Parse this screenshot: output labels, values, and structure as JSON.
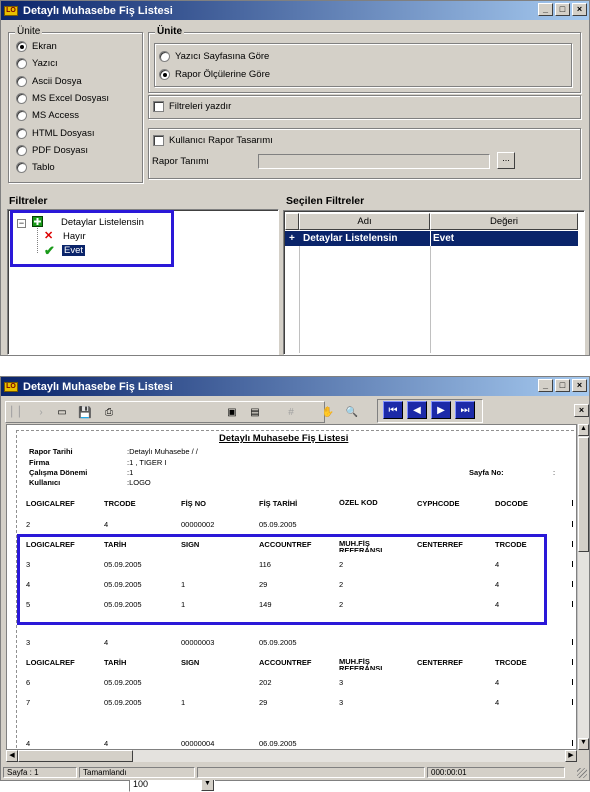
{
  "window1": {
    "title": "Detaylı Muhasebe Fiş Listesi",
    "min_label": "_",
    "max_label": "□",
    "close_label": "×",
    "unite_left": {
      "legend": "Ünite",
      "options": [
        "Ekran",
        "Yazıcı",
        "Ascii Dosya",
        "MS Excel Dosyası",
        "MS Access",
        "HTML Dosyası",
        "PDF Dosyası",
        "Tablo"
      ],
      "selected": 0
    },
    "unite_right": {
      "legend": "Ünite",
      "options": [
        "Yazıcı Sayfasına Göre",
        "Rapor Ölçülerine Göre"
      ],
      "selected": 1
    },
    "filtreleri_yazdir": "Filtreleri yazdır",
    "kullanici_rapor_tasarimi": "Kullanıcı Rapor Tasarımı",
    "rapor_tanimi_label": "Rapor Tanımı",
    "rapor_tanimi_value": "",
    "browse_label": "...",
    "filtreler_heading": "Filtreler",
    "tree": {
      "collapse_glyph": "−",
      "root": "Detaylar Listelensin",
      "children": [
        "Hayır",
        "Evet"
      ],
      "selected_child": "Evet"
    },
    "secilen_heading": "Seçilen Filtreler",
    "secilen_columns": [
      "Adı",
      "Değeri"
    ],
    "secilen_rows": [
      {
        "marker": "+",
        "name": "Detaylar Listelensin",
        "value": "Evet"
      }
    ]
  },
  "window2": {
    "title": "Detaylı Muhasebe Fiş Listesi",
    "min_label": "_",
    "max_label": "□",
    "close_label": "×",
    "zoom_value": "100",
    "close_small": "×",
    "report": {
      "title": "Detaylı Muhasebe Fiş Listesi",
      "header": {
        "rapor_tarihi_label": "Rapor Tarihi",
        "rapor_tarihi_value": ":Detaylı Muhasebe     /  /",
        "firma_label": "Firma",
        "firma_value": ":1          , TIGER I",
        "donem_label": "Çalışma Dönemi",
        "donem_value": ":1",
        "kullanici_label": "Kullanıcı",
        "kullanici_value": ":LOGO",
        "sayfa_label": "Sayfa No:",
        "sayfa_value": ":"
      },
      "hdr1": [
        "LOGICALREF",
        "TRCODE",
        "FİŞ NO",
        "FİŞ TARİHİ",
        "ÖZEL KOD",
        "CYPHCODE",
        "DOCODE"
      ],
      "row1": [
        "2",
        "4",
        "00000002",
        "05.09.2005",
        "",
        "",
        ""
      ],
      "hdr2": [
        "LOGICALREF",
        "TARİH",
        "SIGN",
        "ACCOUNTREF",
        "MUH.FİŞ REFERANSI",
        "CENTERREF",
        "TRCODE"
      ],
      "detail1": [
        [
          "3",
          "05.09.2005",
          "",
          "116",
          "2",
          "",
          "4"
        ],
        [
          "4",
          "05.09.2005",
          "1",
          "29",
          "2",
          "",
          "4"
        ],
        [
          "5",
          "05.09.2005",
          "1",
          "149",
          "2",
          "",
          "4"
        ]
      ],
      "row2": [
        "3",
        "4",
        "00000003",
        "05.09.2005",
        "",
        "",
        ""
      ],
      "hdr3": [
        "LOGICALREF",
        "TARİH",
        "SIGN",
        "ACCOUNTREF",
        "MUH.FİŞ REFERANSI",
        "CENTERREF",
        "TRCODE"
      ],
      "detail2": [
        [
          "6",
          "05.09.2005",
          "",
          "202",
          "3",
          "",
          "4"
        ],
        [
          "7",
          "05.09.2005",
          "1",
          "29",
          "3",
          "",
          "4"
        ]
      ],
      "row3": [
        "4",
        "4",
        "00000004",
        "06.09.2005",
        "",
        "",
        ""
      ]
    },
    "status": {
      "page": "Sayfa : 1",
      "state": "Tamamlandı",
      "time": "000:00:01"
    }
  }
}
